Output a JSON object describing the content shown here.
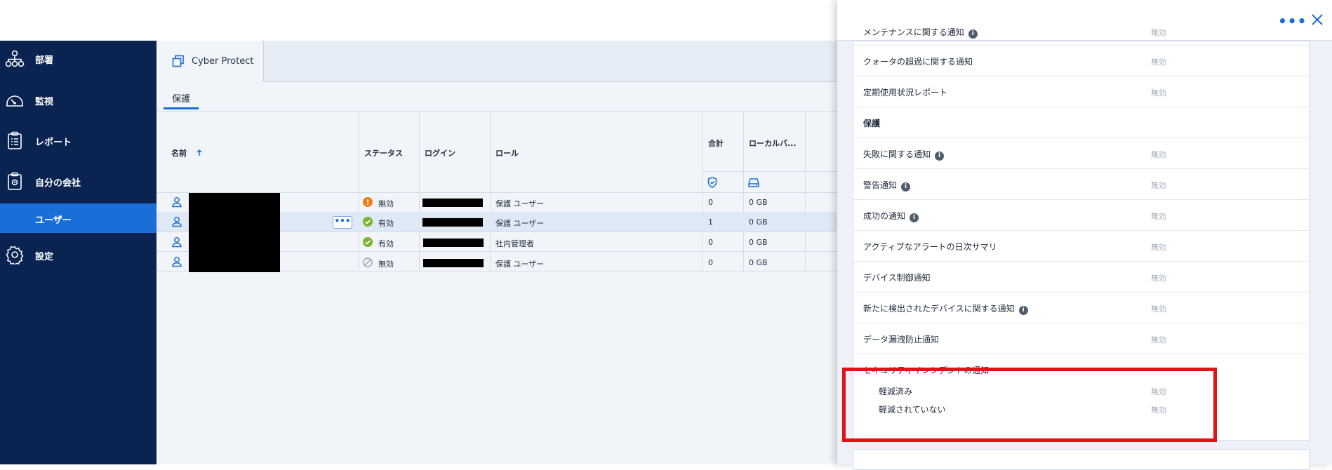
{
  "sidebar": {
    "items": [
      {
        "label": "部署",
        "icon": "org-chart-icon"
      },
      {
        "label": "監視",
        "icon": "speedometer-icon"
      },
      {
        "label": "レポート",
        "icon": "clipboard-icon"
      },
      {
        "label": "自分の会社",
        "icon": "company-gear-icon"
      },
      {
        "label": "ユーザー",
        "icon": ""
      },
      {
        "label": "設定",
        "icon": "gear-icon"
      }
    ]
  },
  "main": {
    "app_tab": "Cyber Protect",
    "subtab": "保護",
    "columns": {
      "name": "名前",
      "status": "ステータス",
      "login": "ログイン",
      "role": "ロール",
      "total": "合計",
      "local_backup": "ローカルバ..."
    },
    "rows": [
      {
        "status": "無効",
        "status_type": "warning",
        "role": "保護 ユーザー",
        "total": "0",
        "local": "0 GB"
      },
      {
        "status": "有効",
        "status_type": "ok",
        "role": "保護 ユーザー",
        "total": "1",
        "local": "0 GB"
      },
      {
        "status": "有効",
        "status_type": "ok",
        "role": "社内管理者",
        "total": "0",
        "local": "0 GB"
      },
      {
        "status": "無効",
        "status_type": "disabled",
        "role": "保護 ユーザー",
        "total": "0",
        "local": "0 GB"
      }
    ]
  },
  "panel": {
    "settings": [
      {
        "label": "メンテナンスに関する通知",
        "value": "無効",
        "info": true
      },
      {
        "label": "クォータの超過に関する通知",
        "value": "無効",
        "info": false
      },
      {
        "label": "定期使用状況レポート",
        "value": "無効",
        "info": false
      },
      {
        "label": "保護",
        "value": "",
        "info": false,
        "section": true
      },
      {
        "label": "失敗に関する通知",
        "value": "無効",
        "info": true
      },
      {
        "label": "警告通知",
        "value": "無効",
        "info": true
      },
      {
        "label": "成功の通知",
        "value": "無効",
        "info": true
      },
      {
        "label": "アクティブなアラートの日次サマリ",
        "value": "無効",
        "info": false
      },
      {
        "label": "デバイス制御通知",
        "value": "無効",
        "info": false
      },
      {
        "label": "新たに検出されたデバイスに関する通知",
        "value": "無効",
        "info": true
      },
      {
        "label": "データ漏洩防止通知",
        "value": "無効",
        "info": false
      }
    ],
    "security": {
      "title": "セキュリティインシデントの通知",
      "mitigated_label": "軽減済み",
      "mitigated_value": "無効",
      "unmitigated_label": "軽減されていない",
      "unmitigated_value": "無効"
    }
  }
}
